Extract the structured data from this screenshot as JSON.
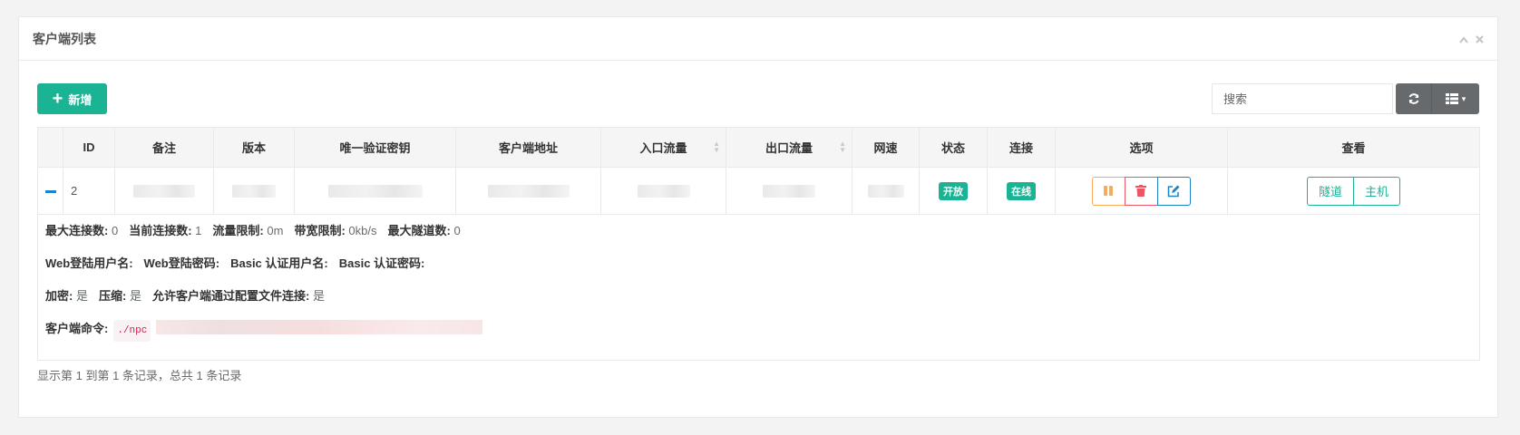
{
  "panel": {
    "title": "客户端列表",
    "collapse_icon": "chevron-up-icon",
    "close_icon": "close-icon"
  },
  "toolbar": {
    "add_label": "新增",
    "search_placeholder": "搜索"
  },
  "table": {
    "headers": [
      "ID",
      "备注",
      "版本",
      "唯一验证密钥",
      "客户端地址",
      "入口流量",
      "出口流量",
      "网速",
      "状态",
      "连接",
      "选项",
      "查看"
    ],
    "row": {
      "id": "2",
      "status": "开放",
      "connection": "在线",
      "view_tunnel": "隧道",
      "view_host": "主机"
    },
    "detail": {
      "line1": [
        {
          "label": "最大连接数:",
          "value": "0"
        },
        {
          "label": "当前连接数:",
          "value": "1"
        },
        {
          "label": "流量限制:",
          "value": "0m"
        },
        {
          "label": "带宽限制:",
          "value": "0kb/s"
        },
        {
          "label": "最大隧道数:",
          "value": "0"
        }
      ],
      "line2": [
        {
          "label": "Web登陆用户名:",
          "value": ""
        },
        {
          "label": "Web登陆密码:",
          "value": ""
        },
        {
          "label": "Basic 认证用户名:",
          "value": ""
        },
        {
          "label": "Basic 认证密码:",
          "value": ""
        }
      ],
      "line3": [
        {
          "label": "加密:",
          "value": "是"
        },
        {
          "label": "压缩:",
          "value": "是"
        },
        {
          "label": "允许客户端通过配置文件连接:",
          "value": "是"
        }
      ],
      "cmd_label": "客户端命令:",
      "cmd_value": "./npc"
    }
  },
  "footer": {
    "summary": "显示第 1 到第 1 条记录，总共 1 条记录"
  },
  "colors": {
    "primary": "#1ab394",
    "warning": "#f8ac59",
    "danger": "#ed5565",
    "info": "#1c84c6",
    "grey": "#676a6c"
  }
}
